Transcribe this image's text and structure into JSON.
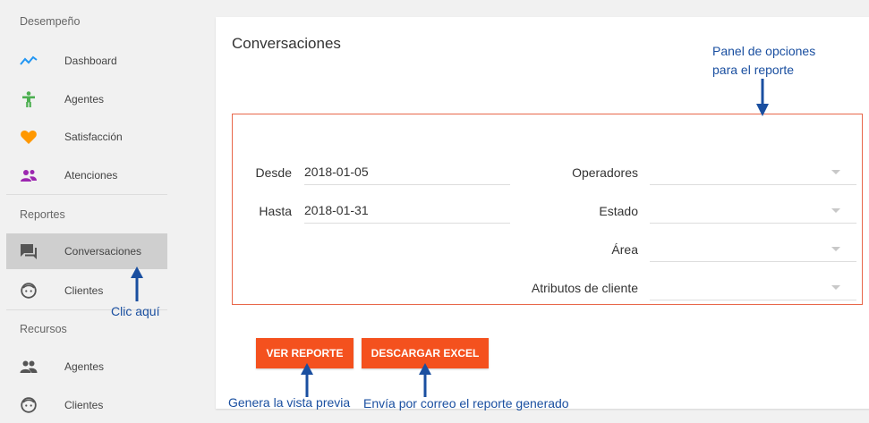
{
  "sidebar": {
    "sections": [
      {
        "title": "Desempeño",
        "items": [
          {
            "label": "Dashboard",
            "icon": "trending-line-icon"
          },
          {
            "label": "Agentes",
            "icon": "person-icon"
          },
          {
            "label": "Satisfacción",
            "icon": "heart-icon"
          },
          {
            "label": "Atenciones",
            "icon": "group-icon"
          }
        ]
      },
      {
        "title": "Reportes",
        "items": [
          {
            "label": "Conversaciones",
            "icon": "chat-icon",
            "active": true
          },
          {
            "label": "Clientes",
            "icon": "face-icon"
          }
        ]
      },
      {
        "title": "Recursos",
        "items": [
          {
            "label": "Agentes",
            "icon": "people-icon"
          },
          {
            "label": "Clientes",
            "icon": "face-icon"
          }
        ]
      }
    ]
  },
  "main": {
    "title": "Conversaciones",
    "filters": {
      "desde_label": "Desde",
      "desde_value": "2018-01-05",
      "hasta_label": "Hasta",
      "hasta_value": "2018-01-31",
      "operadores_label": "Operadores",
      "estado_label": "Estado",
      "area_label": "Área",
      "atributos_label": "Atributos de cliente"
    },
    "buttons": {
      "ver_reporte": "VER REPORTE",
      "descargar_excel": "DESCARGAR EXCEL"
    }
  },
  "annotations": {
    "panel_line1": "Panel de opciones",
    "panel_line2": "para el reporte",
    "clic": "Clic aquí",
    "genera": "Genera la vista previa",
    "envia": "Envía por correo el reporte generado"
  },
  "colors": {
    "accent": "#f4511e",
    "panel_border": "#e8674a",
    "annotation": "#1a4fa0",
    "dashboard_icon": "#2196f3",
    "agentes_icon": "#4caf50",
    "satisfaccion_icon": "#ff9800",
    "atenciones_icon": "#9c27b0"
  }
}
